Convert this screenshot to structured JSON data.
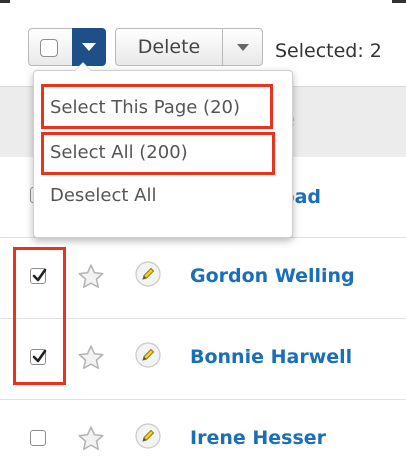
{
  "toolbar": {
    "delete_label": "Delete",
    "selected_text": "Selected: 2"
  },
  "dropdown": {
    "items": [
      {
        "label": "Select This Page (20)"
      },
      {
        "label": "Select All (200)"
      },
      {
        "label": "Deselect All"
      }
    ]
  },
  "header": {
    "partial_text": "e"
  },
  "rows": [
    {
      "name": "bad",
      "checked": false
    },
    {
      "name": "Gordon Welling",
      "checked": true
    },
    {
      "name": "Bonnie Harwell",
      "checked": true
    },
    {
      "name": "Irene Hesser",
      "checked": false
    }
  ],
  "colors": {
    "accent_dark_blue": "#1f4f87",
    "link_blue": "#1a6fb8",
    "highlight_red": "#e8331e"
  }
}
